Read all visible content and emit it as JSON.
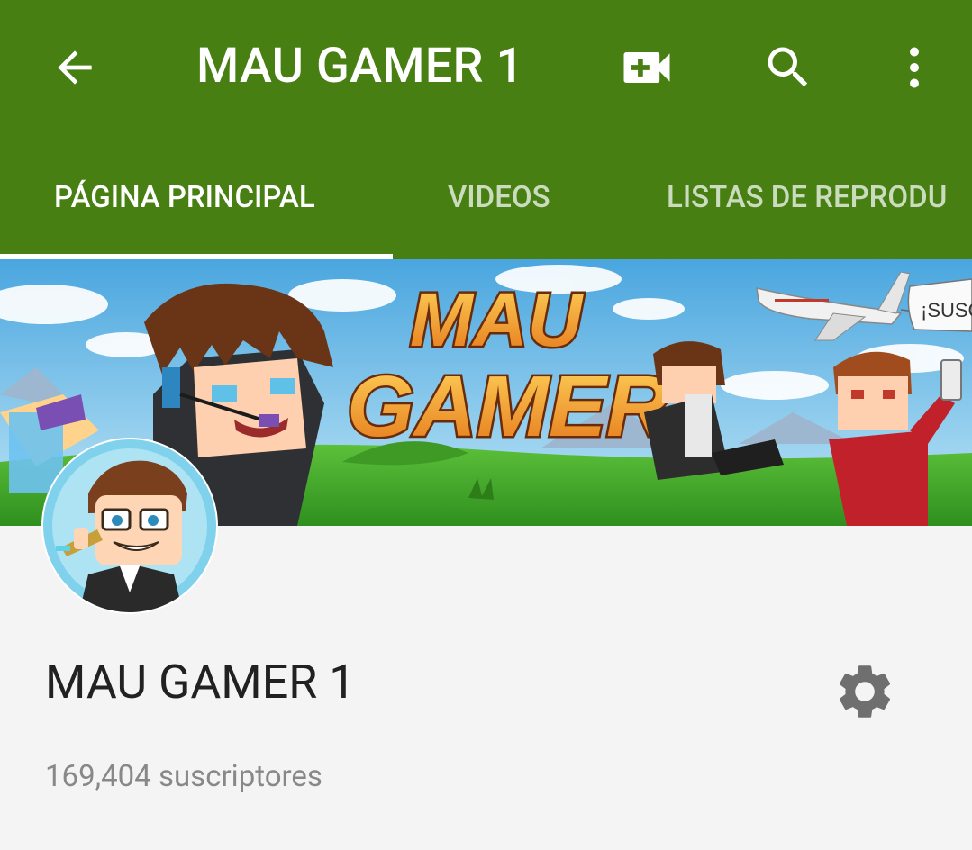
{
  "colors": {
    "brand": "#477f12",
    "toolbar_text": "#ffffff",
    "page_bg": "#f4f4f4",
    "channel_name": "#212121",
    "subscribers": "#888888",
    "settings_icon": "#6f6f6f"
  },
  "toolbar": {
    "back_icon": "arrow-back",
    "title": "MAU GAMER 1",
    "actions": [
      {
        "icon": "video-add"
      },
      {
        "icon": "search"
      },
      {
        "icon": "more-vert"
      }
    ]
  },
  "tabs": [
    {
      "label": "PÁGINA PRINCIPAL",
      "active": true
    },
    {
      "label": "VIDEOS",
      "active": false
    },
    {
      "label": "LISTAS DE REPRODU",
      "active": false
    }
  ],
  "banner": {
    "logo_line1": "MAU",
    "logo_line2": "GAMER",
    "sign_text": "¡SUSC"
  },
  "channel": {
    "name": "MAU GAMER 1",
    "subscribers": "169,404 suscriptores",
    "settings_icon": "gear"
  }
}
